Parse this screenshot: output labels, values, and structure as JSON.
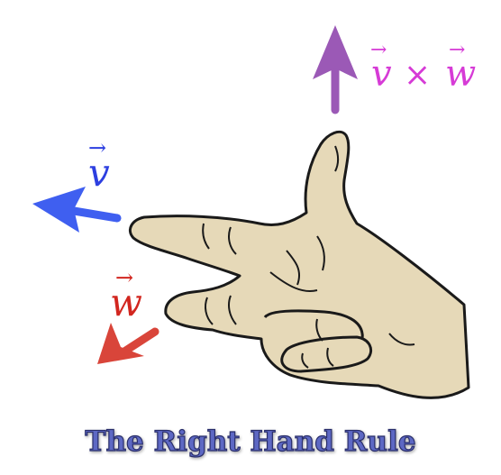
{
  "title": "The Right Hand Rule",
  "labels": {
    "cross_vector_left": "v",
    "cross_operator": "×",
    "cross_vector_right": "w",
    "v_vector": "v",
    "w_vector": "w"
  },
  "colors": {
    "cross_arrow": "#9b59b6",
    "cross_label": "#d63bd6",
    "v_arrow": "#3f5ff0",
    "v_label": "#2d3fe0",
    "w_arrow": "#d9453a",
    "w_label": "#d2261f",
    "hand_fill": "#e6d9b8",
    "hand_outline": "#1a1a1a",
    "title_fill": "#5d68c4",
    "title_stroke": "#2a2f6a"
  },
  "icons": {
    "hand": "right-hand-illustration",
    "v_arrow": "arrow-left-icon",
    "w_arrow": "arrow-down-left-icon",
    "cross_arrow": "arrow-up-icon"
  }
}
